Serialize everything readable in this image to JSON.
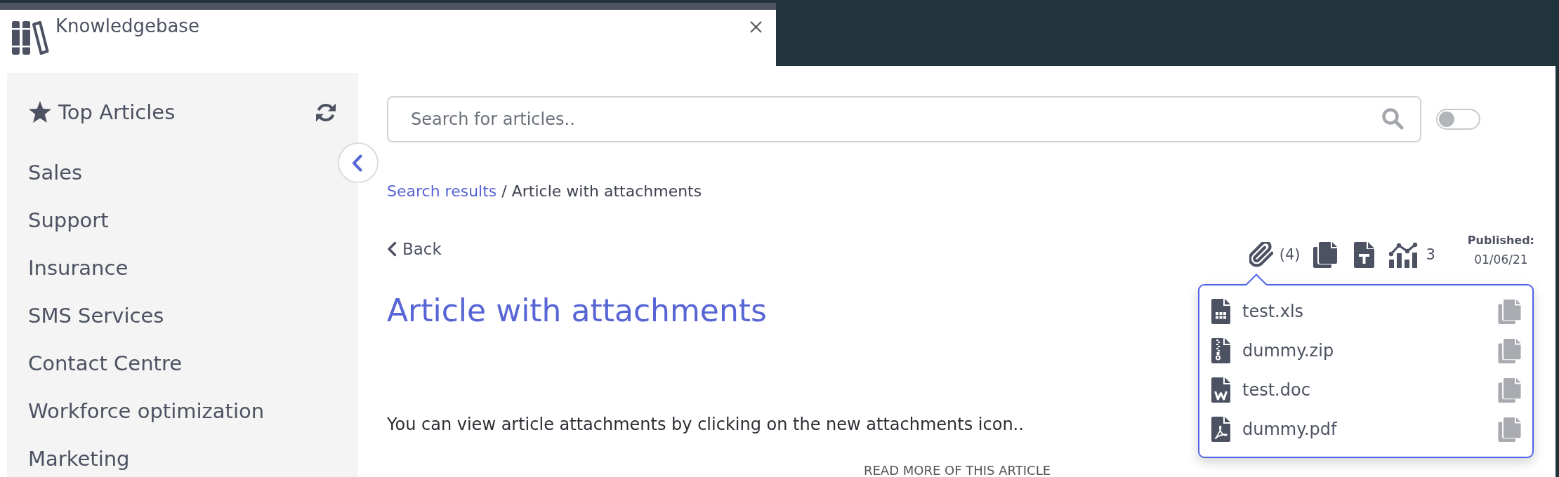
{
  "window": {
    "title": "Knowledgebase"
  },
  "sidebar": {
    "heading": "Top Articles",
    "items": [
      {
        "label": "Sales"
      },
      {
        "label": "Support"
      },
      {
        "label": "Insurance"
      },
      {
        "label": "SMS Services"
      },
      {
        "label": "Contact Centre"
      },
      {
        "label": "Workforce optimization"
      },
      {
        "label": "Marketing"
      }
    ]
  },
  "search": {
    "placeholder": "Search for articles..",
    "toggle_on": false
  },
  "breadcrumb": {
    "link": "Search results",
    "separator": "/",
    "current": "Article with attachments"
  },
  "back": {
    "label": "Back"
  },
  "toolbar": {
    "attachment_count": "(4)",
    "stats_count": "3",
    "published_label": "Published:",
    "published_date": "01/06/21"
  },
  "attachments": {
    "expanded": true,
    "files": [
      {
        "name": "test.xls",
        "kind": "spreadsheet"
      },
      {
        "name": "dummy.zip",
        "kind": "archive"
      },
      {
        "name": "test.doc",
        "kind": "word"
      },
      {
        "name": "dummy.pdf",
        "kind": "pdf"
      }
    ]
  },
  "article": {
    "title": "Article with attachments",
    "body": "You can view article attachments by clicking on the new attachments icon..",
    "read_more": "READ MORE OF THIS ARTICLE"
  }
}
